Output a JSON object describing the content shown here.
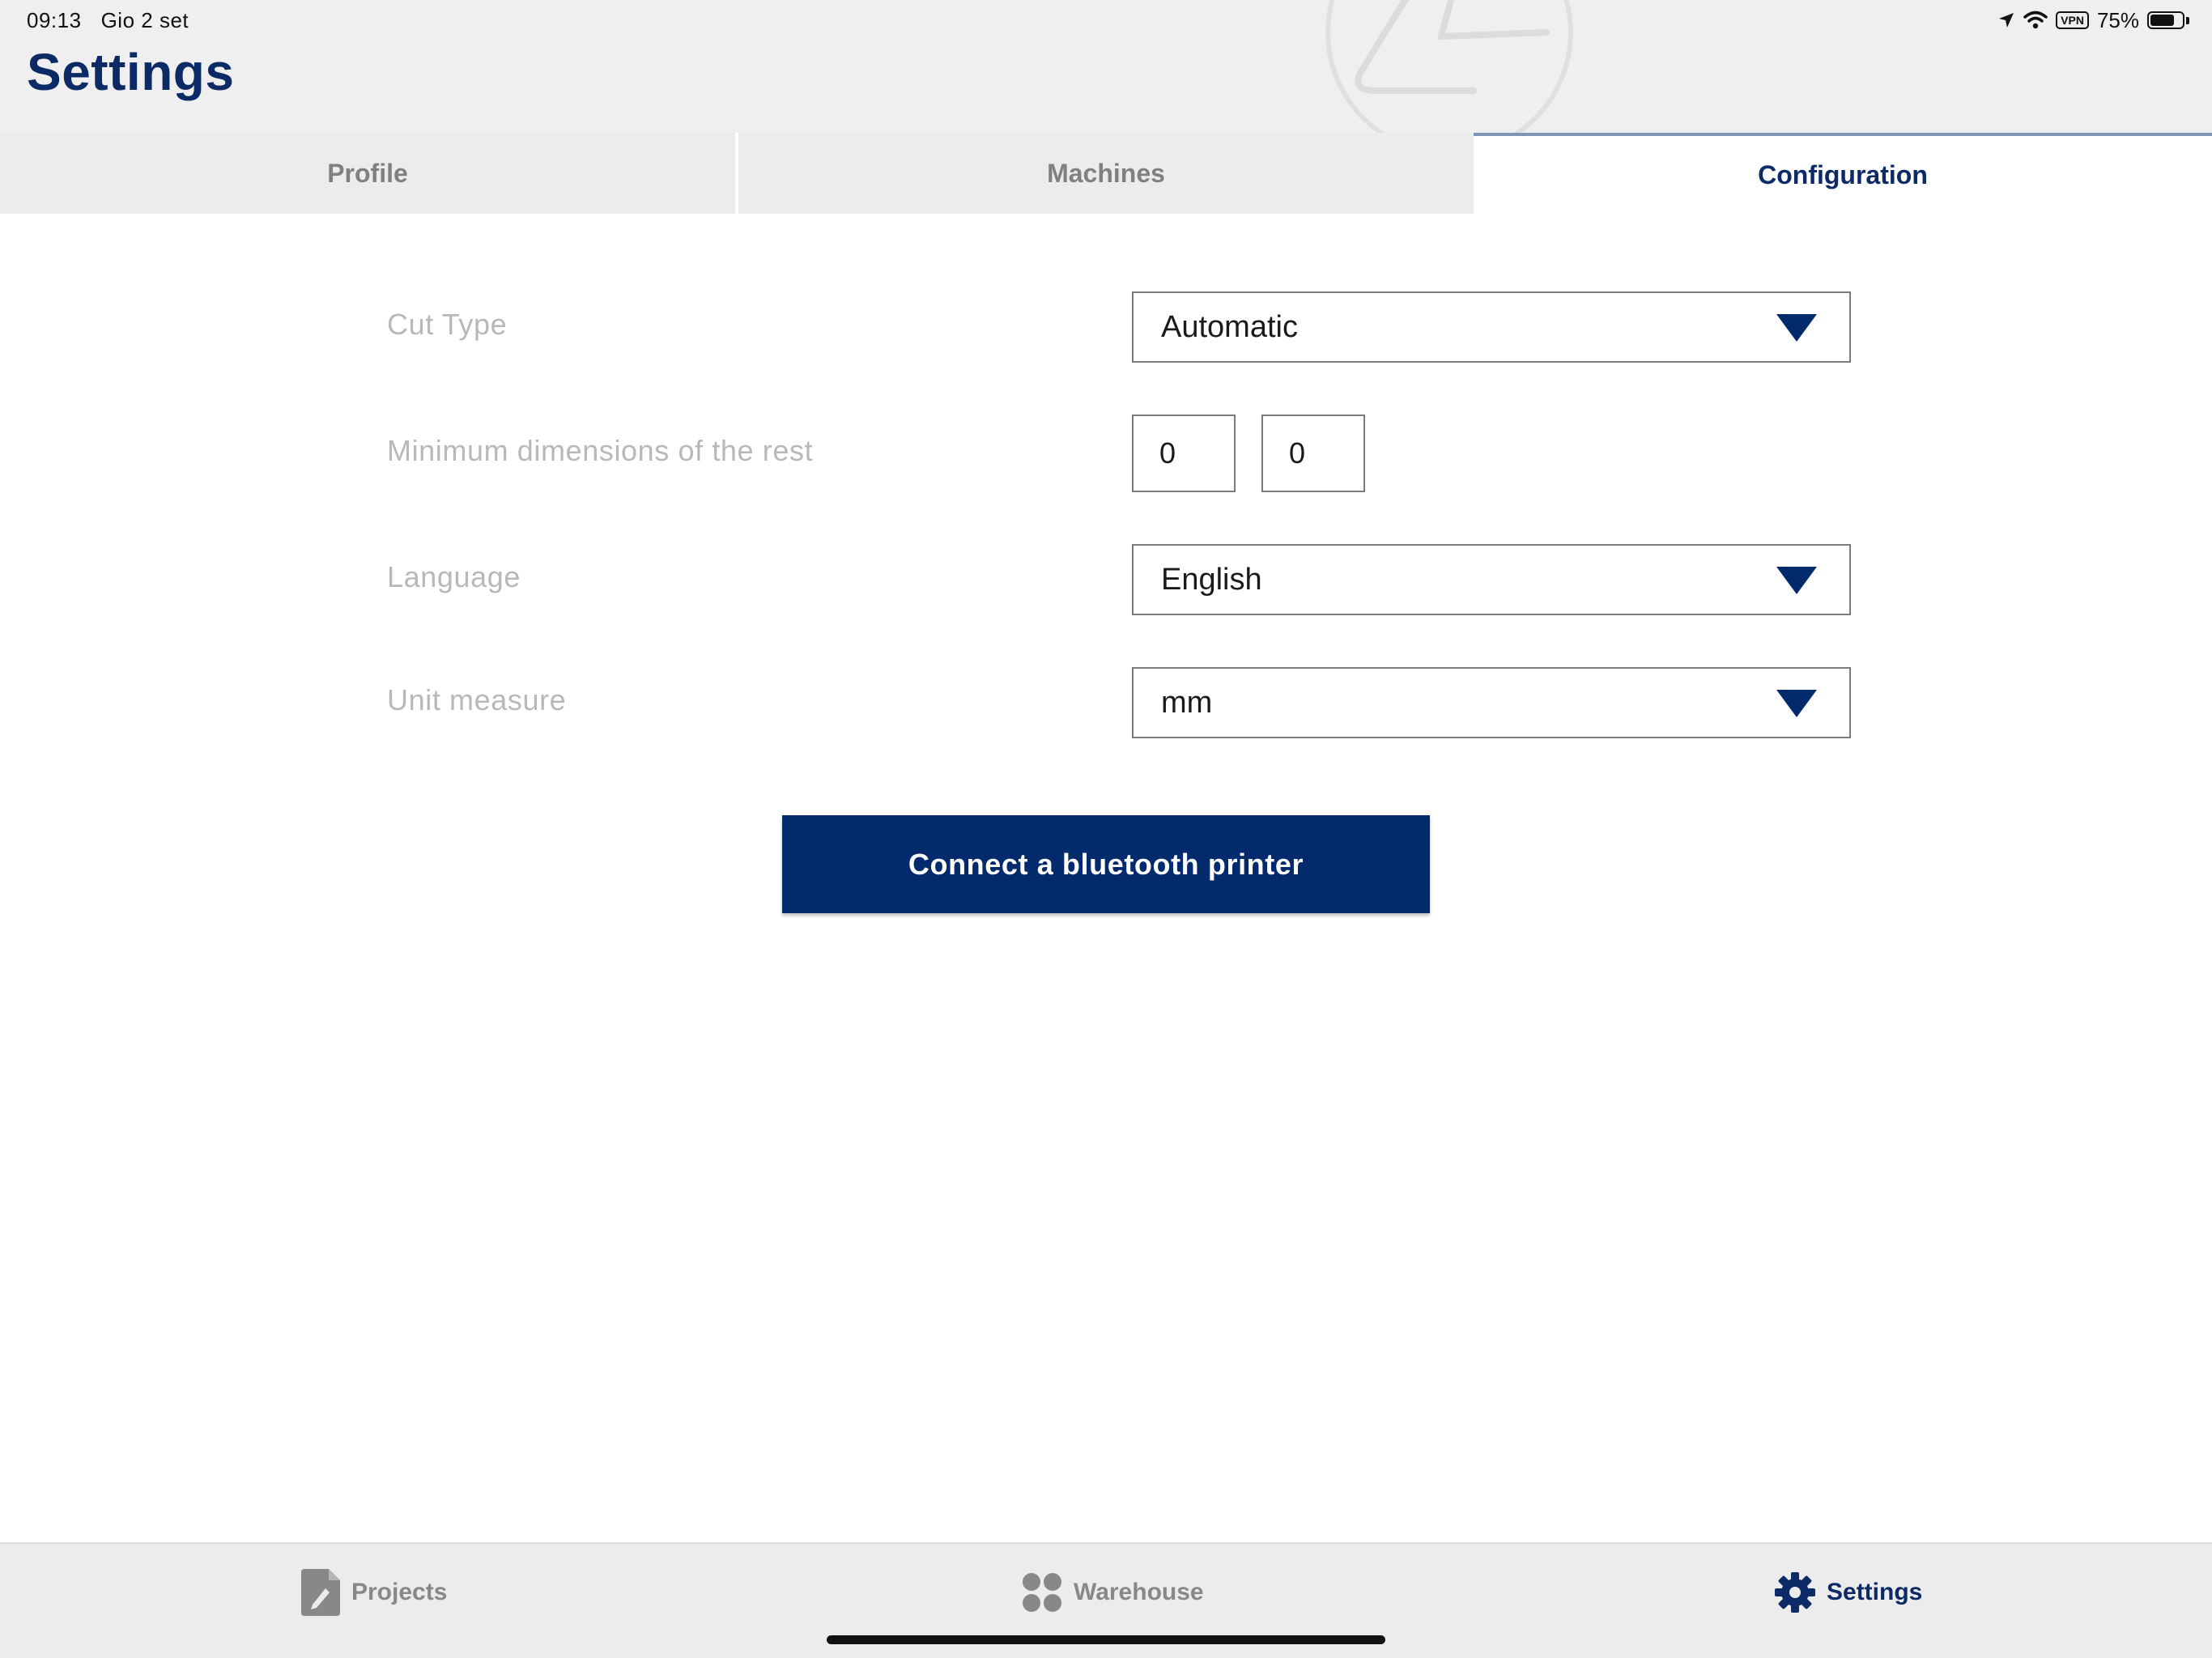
{
  "status_bar": {
    "time": "09:13",
    "date": "Gio 2 set",
    "vpn": "VPN",
    "battery": "75%",
    "battery_level": 0.75
  },
  "header": {
    "title": "Settings"
  },
  "tabs": [
    {
      "label": "Profile",
      "active": false
    },
    {
      "label": "Machines",
      "active": false
    },
    {
      "label": "Configuration",
      "active": true
    }
  ],
  "form": {
    "cut_type": {
      "label": "Cut Type",
      "value": "Automatic"
    },
    "min_dimensions": {
      "label": "Minimum dimensions of the rest",
      "value_1": "0",
      "value_2": "0"
    },
    "language": {
      "label": "Language",
      "value": "English"
    },
    "unit_measure": {
      "label": "Unit measure",
      "value": "mm"
    }
  },
  "buttons": {
    "connect_printer": "Connect a bluetooth printer"
  },
  "bottom_nav": [
    {
      "label": "Projects",
      "icon": "document-edit-icon",
      "active": false
    },
    {
      "label": "Warehouse",
      "icon": "grid-dots-icon",
      "active": false
    },
    {
      "label": "Settings",
      "icon": "gear-icon",
      "active": true
    }
  ],
  "colors": {
    "brand_navy": "#022a6d",
    "title_navy": "#0b2a66",
    "label_gray": "#b8b8b8",
    "tab_bg": "#ececec",
    "nav_gray": "#888888"
  }
}
